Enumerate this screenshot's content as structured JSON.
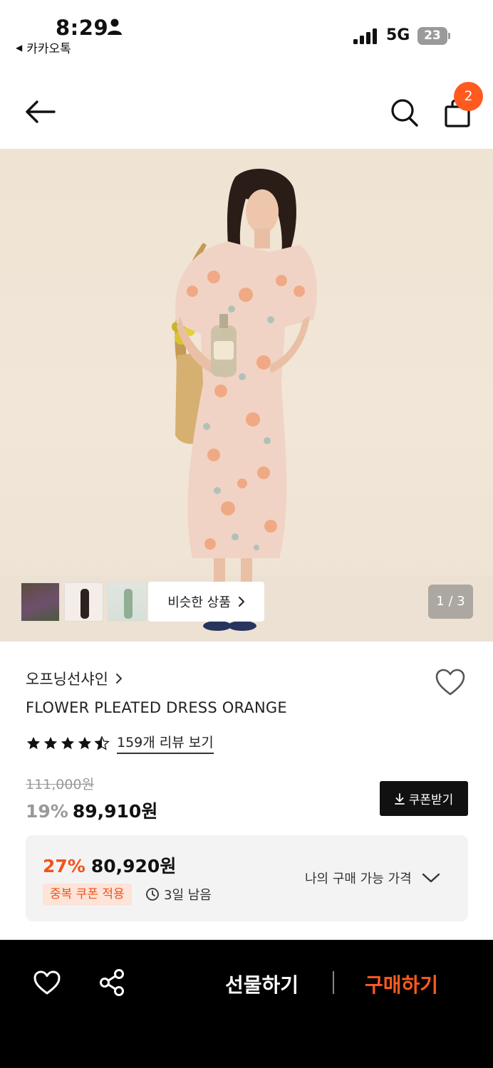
{
  "status_bar": {
    "time": "8:29",
    "back_app": "카카오톡",
    "network": "5G",
    "battery": "23"
  },
  "nav": {
    "cart_count": "2"
  },
  "gallery": {
    "similar_label": "비슷한 상품",
    "page_indicator": "1 / 3"
  },
  "product": {
    "brand": "오프닝선샤인",
    "name": "FLOWER PLEATED DRESS ORANGE",
    "rating": 4.5,
    "review_link": "159개 리뷰 보기",
    "original_price": "111,000원",
    "discount": "19%",
    "price": "89,910원",
    "coupon_button": "쿠폰받기"
  },
  "best_price": {
    "discount": "27%",
    "price": "80,920원",
    "tag": "중복 쿠폰 적용",
    "remaining": "3일 남음",
    "my_price_label": "나의 구매 가능 가격"
  },
  "bottom_bar": {
    "gift": "선물하기",
    "buy": "구매하기"
  },
  "colors": {
    "accent": "#ff5a1f",
    "accent_text": "#f0541a",
    "tag_bg": "#fde3d8"
  }
}
